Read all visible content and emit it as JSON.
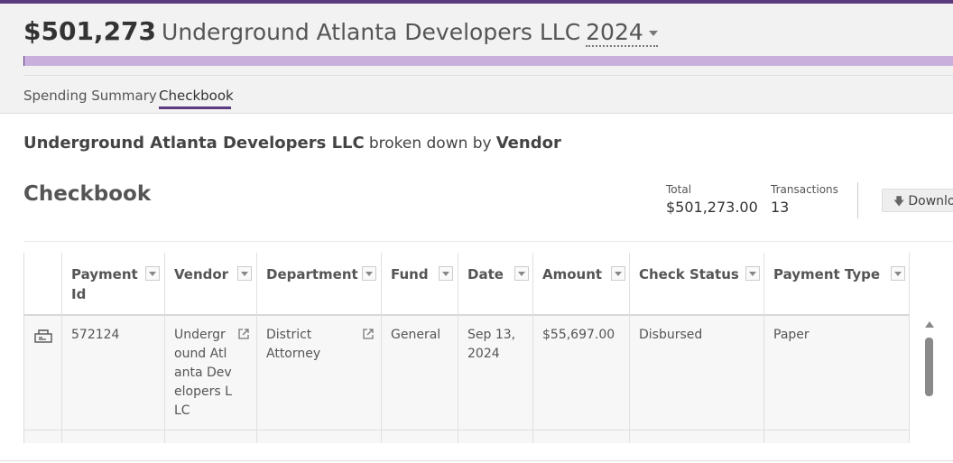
{
  "header": {
    "amount": "$501,273",
    "entity": "Underground Atlanta Developers LLC",
    "year": "2024",
    "progress_fraction": 1.0
  },
  "tabs": [
    {
      "label": "Spending Summary",
      "active": false
    },
    {
      "label": "Checkbook",
      "active": true
    }
  ],
  "breakdown": {
    "entity": "Underground Atlanta Developers LLC",
    "middle": "broken down by",
    "dimension": "Vendor"
  },
  "section": {
    "title": "Checkbook",
    "total_label": "Total",
    "total_value": "$501,273.00",
    "transactions_label": "Transactions",
    "transactions_value": "13",
    "download_label": "Download"
  },
  "table": {
    "columns": [
      "Payment Id",
      "Vendor",
      "Department",
      "Fund",
      "Date",
      "Amount",
      "Check Status",
      "Payment Type"
    ],
    "rows": [
      {
        "payment_id": "572124",
        "vendor": "Underground Atlanta Developers LLC",
        "department": "District Attorney",
        "fund": "General",
        "date": "Sep 13, 2024",
        "amount": "$55,697.00",
        "check_status": "Disbursed",
        "payment_type": "Paper"
      }
    ]
  },
  "colors": {
    "accent": "#5c3a80",
    "progress": "#c9b0dc"
  },
  "icons": [
    "caret-down-icon",
    "download-arrow-icon",
    "filter-icon",
    "external-link-icon",
    "check-icon",
    "scroll-up-icon"
  ]
}
